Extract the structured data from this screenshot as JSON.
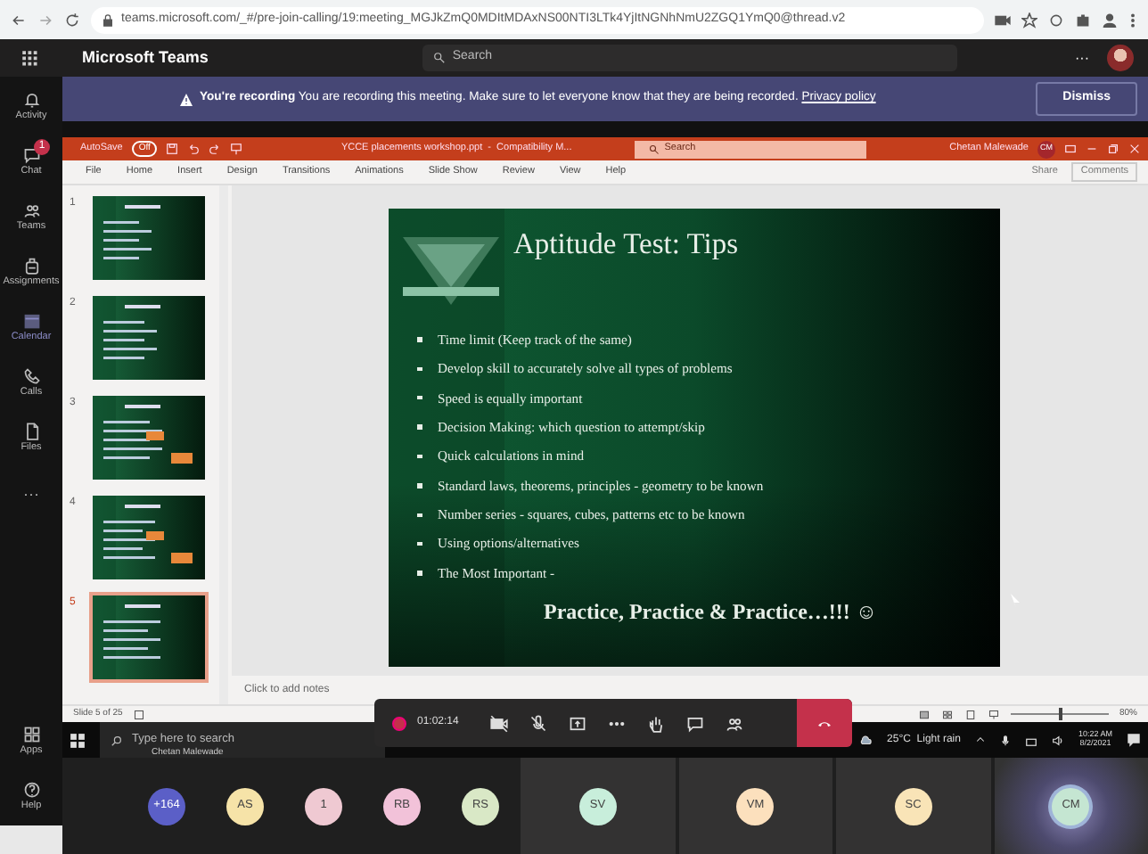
{
  "browser": {
    "url": "teams.microsoft.com/_#/pre-join-calling/19:meeting_MGJkZmQ0MDItMDAxNS00NTI3LTk4YjItNGNhNmU2ZGQ1YmQ0@thread.v2"
  },
  "teams_bar": {
    "title": "Microsoft Teams",
    "search_placeholder": "Search",
    "more": "···"
  },
  "rail": [
    {
      "label": "Activity",
      "selected": false
    },
    {
      "label": "Chat",
      "selected": false,
      "badge": "1"
    },
    {
      "label": "Teams",
      "selected": false
    },
    {
      "label": "Assignments",
      "selected": false
    },
    {
      "label": "Calendar",
      "selected": true
    },
    {
      "label": "Calls",
      "selected": false
    },
    {
      "label": "Files",
      "selected": false
    }
  ],
  "rail_more": "···",
  "rail_bottom": [
    {
      "label": "Apps"
    },
    {
      "label": "Help"
    }
  ],
  "banner": {
    "title": "You're recording",
    "message": "You are recording this meeting. Make sure to let everyone know that they are being recorded.",
    "link": "Privacy policy",
    "button": "Dismiss"
  },
  "ppt": {
    "autosave_label": "AutoSave",
    "autosave_on": false,
    "toggle_text": "Off",
    "title": "YCCE placements workshop.ppt  -  Compatibility M...",
    "search_placeholder": "Search",
    "user": "Chetan Malewade",
    "user_initials": "CM",
    "tabs": [
      "File",
      "Home",
      "Insert",
      "Design",
      "Transitions",
      "Animations",
      "Slide Show",
      "Review",
      "View",
      "Help"
    ],
    "share": "Share",
    "comments": "Comments"
  },
  "thumbnails": [
    {
      "number": "1",
      "selected": false
    },
    {
      "number": "2",
      "selected": false
    },
    {
      "number": "3",
      "selected": false
    },
    {
      "number": "4",
      "selected": false
    },
    {
      "number": "5",
      "selected": true
    }
  ],
  "slide": {
    "title": "Aptitude Test: Tips",
    "bullets": [
      "Time limit (Keep track of the same)",
      "Develop skill to accurately solve all types of problems",
      "Speed is equally important",
      "Decision Making: which question to attempt/skip",
      "Quick calculations in mind",
      "Standard laws, theorems, principles - geometry to be known",
      "Number series - squares, cubes, patterns etc to be known",
      "Using options/alternatives",
      "The Most Important -"
    ],
    "closing": "Practice, Practice & Practice…!!! ☺"
  },
  "notes_placeholder": "Click to add notes",
  "status_bar": {
    "slide_count": "Slide 5 of 25",
    "zoom": {
      "level": 0.5,
      "reading": "80%"
    }
  },
  "call_controls": {
    "recording": true,
    "timer": "01:02:14"
  },
  "taskbar": {
    "search_placeholder": "Type here to search",
    "tooltip": "Chetan Malewade",
    "weather": "25°C  Light rain",
    "time": "10:22 AM",
    "date": "8/2/2021"
  },
  "participants": [
    {
      "initials": "+164",
      "color": "#5b5fc7",
      "tile": false,
      "speaking": false
    },
    {
      "initials": "AS",
      "color": "#f6e3a8",
      "tile": false,
      "speaking": false
    },
    {
      "initials": "1",
      "color": "#efc9d2",
      "tile": false,
      "speaking": false
    },
    {
      "initials": "RB",
      "color": "#f2c2d9",
      "tile": false,
      "speaking": false
    },
    {
      "initials": "RS",
      "color": "#d9e8c6",
      "tile": false,
      "speaking": false
    },
    {
      "initials": "SV",
      "color": "#c8eedb",
      "tile": true,
      "speaking": false
    },
    {
      "initials": "VM",
      "color": "#fce0bd",
      "tile": true,
      "speaking": false
    },
    {
      "initials": "SC",
      "color": "#f9e4b7",
      "tile": true,
      "speaking": false
    },
    {
      "initials": "CM",
      "color": "#c5e6d2",
      "tile": true,
      "speaking": true
    }
  ]
}
